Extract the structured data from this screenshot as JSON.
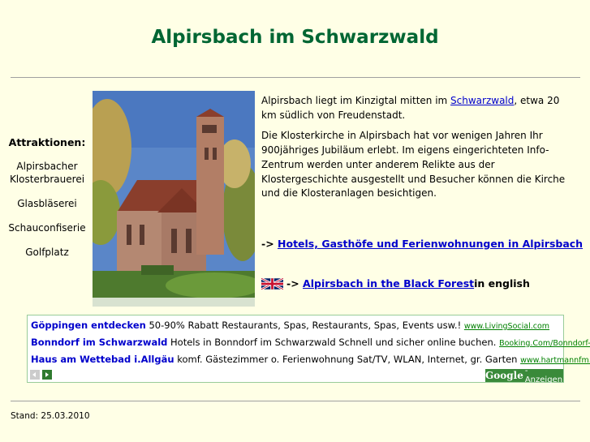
{
  "page": {
    "title": "Alpirsbach im Schwarzwald"
  },
  "sidebar": {
    "heading": "Attraktionen:",
    "items": [
      {
        "label": "Alpirsbacher Klosterbrauerei"
      },
      {
        "label": "Glasbläserei"
      },
      {
        "label": "Schauconfiserie"
      },
      {
        "label": "Golfplatz"
      }
    ]
  },
  "content": {
    "p1_before": "Alpirsbach liegt im Kinzigtal mitten im ",
    "p1_link": "Schwarzwald",
    "p1_after": ", etwa 20 km südlich von Freudenstadt.",
    "p2": "Die Klosterkirche in Alpirsbach hat vor wenigen Jahren Ihr 900jähriges Jubiläum erlebt. Im eigens eingerichteten Info-Zentrum werden unter anderem Relikte aus der Klostergeschichte ausgestellt und Besucher können die Kirche und die Klosteranlagen besichtigen."
  },
  "links": {
    "hotels_prefix": "-> ",
    "hotels_label": "Hotels, Gasthöfe und Ferienwohnungen in Alpirsbach",
    "english_prefix": " -> ",
    "english_label": "Alpirsbach in the Black Forest",
    "english_suffix": " in english"
  },
  "ads": {
    "items": [
      {
        "title": "Göppingen entdecken",
        "text": " 50-90% Rabatt Restaurants, Spas, Restaurants, Spas, Events usw.! ",
        "url": "www.LivingSocial.com"
      },
      {
        "title": "Bonndorf im Schwarzwald",
        "text": " Hotels in Bonndorf im Schwarzwald Schnell und sicher online buchen. ",
        "url": "Booking.Com/Bonndorf-Im-Sch"
      },
      {
        "title": "Haus am Wettebad i.Allgäu",
        "text": " komf. Gästezimmer o. Ferienwohnung Sat/TV, WLAN, Internet, gr. Garten ",
        "url": "www.hartmannfm.de"
      }
    ],
    "badge_brand": "Google",
    "badge_text": "-Anzeigen"
  },
  "footer": {
    "stand": "Stand: 25.03.2010"
  },
  "colors": {
    "background": "#ffffe6",
    "title": "#006633",
    "link": "#0000cc",
    "ad_url": "#008000"
  }
}
